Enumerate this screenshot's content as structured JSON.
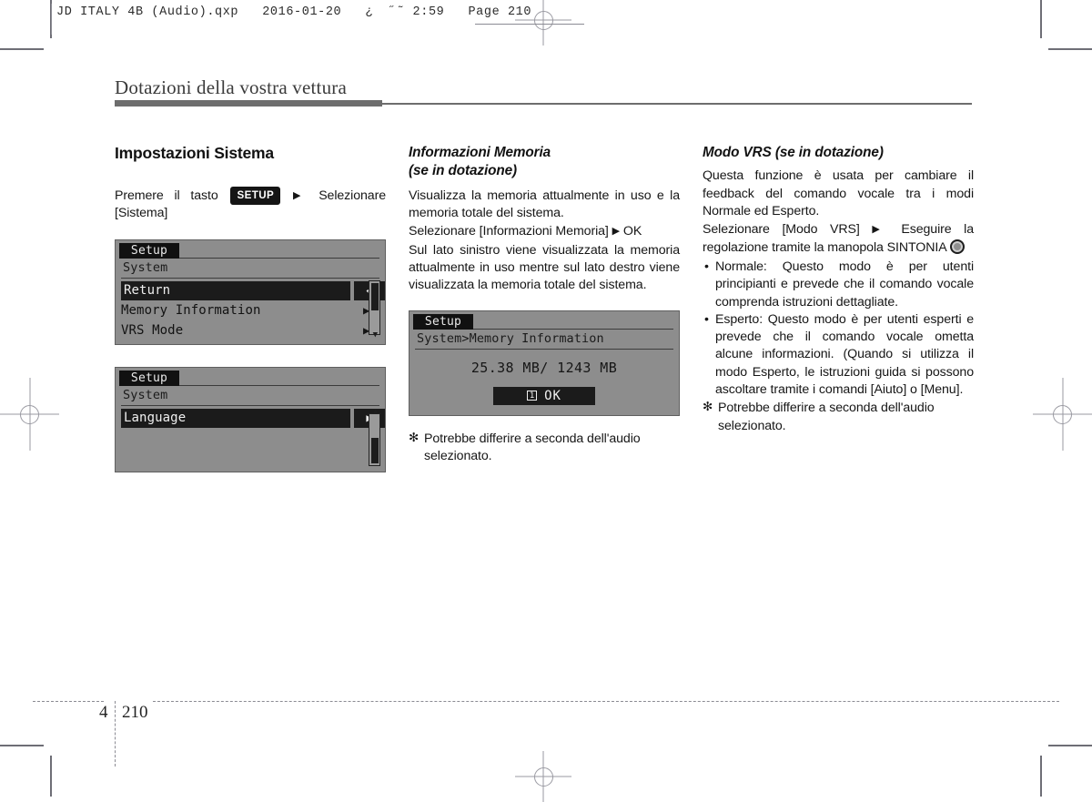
{
  "slug": {
    "text": "JD ITALY 4B (Audio).qxp   2016-01-20   ¿  ˝˜ 2:59   Page 210"
  },
  "header": {
    "chapter_title": "Dotazioni della vostra vettura"
  },
  "footer": {
    "chapter_number": "4",
    "page_number": "210"
  },
  "col1": {
    "section_title": "Impostazioni Sistema",
    "instruction_pre": "Premere il tasto",
    "key_label": "SETUP",
    "arrow": "▶",
    "instruction_post": "Selezionare [Sistema]",
    "screen1": {
      "tab": "Setup",
      "breadcrumb": "System",
      "rows": [
        {
          "label": "Return",
          "selected": true,
          "arrow": "↩"
        },
        {
          "label": "Memory Information",
          "selected": false,
          "arrow": "▶"
        },
        {
          "label": "VRS Mode",
          "selected": false,
          "arrow": "▶"
        }
      ],
      "scroll_cap_bottom": "▼"
    },
    "screen2": {
      "tab": "Setup",
      "breadcrumb": "System",
      "rows": [
        {
          "label": "Language",
          "selected": true,
          "arrow": "▶"
        }
      ],
      "scroll_cap_top": "▲"
    }
  },
  "col2": {
    "section_title_line1": "Informazioni Memoria",
    "section_title_line2": "(se in dotazione)",
    "para1": "Visualizza la memoria attualmente in uso e la memoria totale del sistema.",
    "para2_pre": "Selezionare [Informazioni Memoria]",
    "para2_arrow": "▶",
    "para2_post": "OK",
    "para3": "Sul lato sinistro viene visualizzata la memoria attualmente in uso mentre sul lato destro viene visualizzata la memoria totale del sistema.",
    "screen": {
      "tab": "Setup",
      "breadcrumb": "System>Memory Information",
      "value": "25.38 MB/ 1243 MB",
      "ok_number": "1",
      "ok_label": "OK"
    },
    "note_star": "✻",
    "note": "Potrebbe differire a seconda dell'audio selezionato."
  },
  "col3": {
    "section_title": "Modo VRS (se in dotazione)",
    "para1": "Questa funzione è usata per cambiare il feedback del comando vocale tra i modi Normale ed Esperto.",
    "para2_pre": "Selezionare [Modo VRS]",
    "para2_arrow": "▶",
    "para2_post": "Eseguire la regolazione tramite la manopola SINTONIA",
    "knob_icon": "tune-knob-icon",
    "bullets": [
      {
        "dot": "•",
        "text": "Normale: Questo modo è per utenti principianti e prevede che il comando vocale comprenda istruzioni dettagliate."
      },
      {
        "dot": "•",
        "text": "Esperto: Questo modo è per utenti esperti e prevede che il comando vocale ometta alcune informazioni. (Quando si utilizza il modo Esperto, le istruzioni guida si possono ascoltare tramite i comandi [Aiuto] o [Menu]."
      }
    ],
    "note_star": "✻",
    "note": "Potrebbe differire a seconda dell'audio selezionato."
  }
}
